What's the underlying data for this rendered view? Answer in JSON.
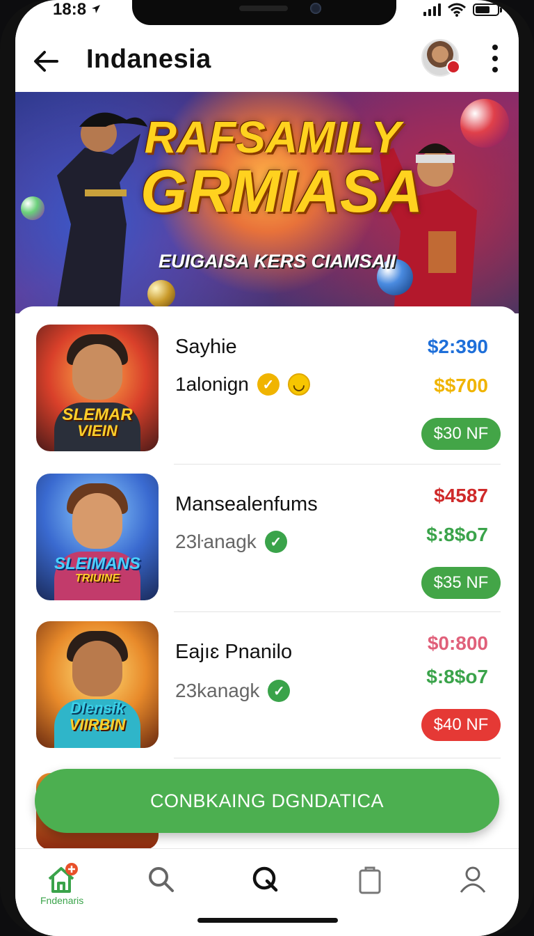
{
  "status": {
    "time": "18:8"
  },
  "appbar": {
    "title": "Indanesia"
  },
  "banner": {
    "title_line1": "RAFSAMILY",
    "title_line2": "GRMIASA",
    "subtitle": "EUIGAISA KERS CIAMSAII"
  },
  "items": [
    {
      "thumb_caption_1": "SLEMAR",
      "thumb_caption_2": "VIEIN",
      "name": "Sayhie",
      "sub": "1alonign",
      "price1": "$2:390",
      "price1_color": "#1e6fd9",
      "price2": "$$700",
      "price2_color": "#f0b400",
      "action": "$30 NF",
      "action_color": "#43a547"
    },
    {
      "thumb_caption_1": "SLEIMANS",
      "thumb_caption_2": "TRIUINE",
      "name": "Mansealenfums",
      "sub": "23ŀanagk",
      "price1": "$4587",
      "price1_color": "#cf2a2a",
      "price2": "$:8$o7",
      "price2_color": "#3aa34a",
      "action": "$35 NF",
      "action_color": "#43a547"
    },
    {
      "thumb_caption_1": "Dlensik",
      "thumb_caption_2": "VIIRBIN",
      "name": "Eajıɛ Pnanilo",
      "sub": "23kanagk",
      "price1": "$0:800",
      "price1_color": "#e0607a",
      "price2": "$:8$o7",
      "price2_color": "#3aa34a",
      "action": "$40 NF",
      "action_color": "#e53935"
    }
  ],
  "cta": {
    "label": "CONBKAING DGNDATICA"
  },
  "tabbar": {
    "home_label": "Fndenaris",
    "accent": "#3aa34a",
    "icons": [
      "home-icon",
      "search-icon",
      "q-icon",
      "bag-icon",
      "profile-icon"
    ]
  }
}
